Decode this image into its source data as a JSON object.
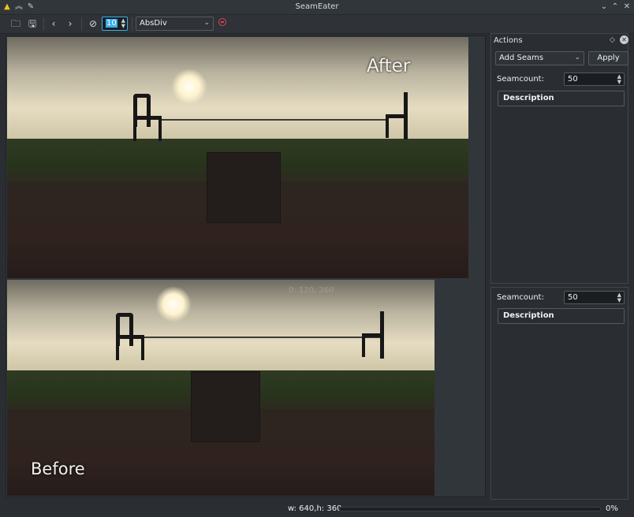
{
  "window": {
    "title": "SeamEater"
  },
  "titlebar_icons": [
    "app-icon",
    "keep-above-icon",
    "pin-icon",
    "minimize-icon",
    "maximize-icon",
    "close-icon"
  ],
  "toolbar": {
    "seam_step": "10",
    "mode_selected": "AbsDiv"
  },
  "images": {
    "after_label": "After",
    "before_label": "Before",
    "ghost_coords": "0: 120, 360"
  },
  "actions_panel": {
    "title": "Actions",
    "action_selected": "Add Seams",
    "apply_label": "Apply",
    "seamcount_label": "Seamcount:",
    "seamcount_value": "50",
    "description_label": "Description"
  },
  "actions_panel_ghost": {
    "seamcount_label": "Seamcount:",
    "seamcount_value": "50",
    "description_label": "Description"
  },
  "status": {
    "image_size": "w: 640,h: 360",
    "progress_percent": "0%",
    "progress_fraction": 0
  }
}
